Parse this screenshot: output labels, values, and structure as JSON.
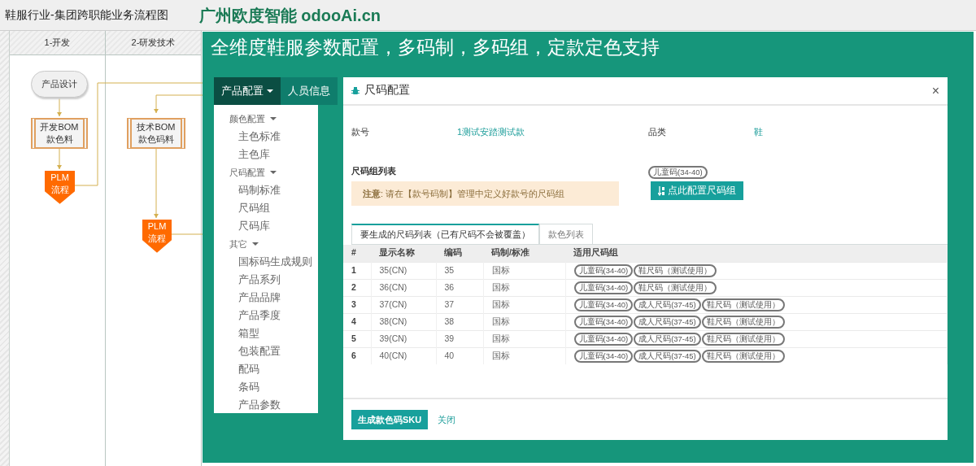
{
  "header": {
    "title": "鞋服行业-集团跨职能业务流程图",
    "brand": "广州欧度智能 odooAi.cn"
  },
  "lanes": [
    {
      "label": "1-开发"
    },
    {
      "label": "2-研发技术"
    }
  ],
  "flow_nodes": [
    {
      "kind": "terminal",
      "lines": [
        "产品设计"
      ]
    },
    {
      "kind": "process",
      "lines": [
        "开发BOM",
        "款色料"
      ]
    },
    {
      "kind": "offpage",
      "lines": [
        "PLM",
        "流程"
      ]
    },
    {
      "kind": "process",
      "lines": [
        "技术BOM",
        "款色码料"
      ]
    },
    {
      "kind": "offpage",
      "lines": [
        "PLM",
        "流程"
      ]
    }
  ],
  "panel": {
    "heading": "全维度鞋服参数配置，多码制，多码组，定款定色支持",
    "nav": [
      {
        "label": "产品配置",
        "selected": true,
        "dropdown": true
      },
      {
        "label": "人员信息",
        "selected": false,
        "dropdown": false
      }
    ],
    "menu": [
      {
        "label": "颜色配置",
        "children": [
          {
            "label": "主色标准"
          },
          {
            "label": "主色库"
          }
        ]
      },
      {
        "label": "尺码配置",
        "children": [
          {
            "label": "码制标准"
          },
          {
            "label": "尺码组"
          },
          {
            "label": "尺码库"
          }
        ]
      },
      {
        "label": "其它",
        "children": [
          {
            "label": "国标码生成规则"
          },
          {
            "label": "产品系列"
          },
          {
            "label": "产品品牌"
          },
          {
            "label": "产品季度"
          },
          {
            "label": "箱型"
          },
          {
            "label": "包装配置"
          },
          {
            "label": "配码"
          },
          {
            "label": "条码"
          },
          {
            "label": "产品参数"
          }
        ]
      }
    ]
  },
  "modal": {
    "title": "尺码配置",
    "close": "×",
    "fields": [
      {
        "label": "款号",
        "value": "1测试安踏测试款"
      },
      {
        "label": "品类",
        "value": "鞋"
      }
    ],
    "size_groups_label": "尺码组列表",
    "notice": "**注意**: 请在【款号码制】管理中定义好款号的尺码组",
    "size_group_tags": [
      "儿童码(34-40)"
    ],
    "config_button": "点此配置尺码组",
    "tabs": [
      {
        "label": "要生成的尺码列表（已有尺码不会被覆盖）",
        "selected": true
      },
      {
        "label": "款色列表",
        "selected": false
      }
    ],
    "table": {
      "columns": [
        "#",
        "显示名称",
        "编码",
        "码制/标准",
        "适用尺码组"
      ],
      "rows": [
        {
          "cells": [
            "1",
            "35(CN)",
            "35",
            "国标"
          ],
          "groups": [
            "儿童码(34-40)",
            "鞋尺码（测试使用）"
          ]
        },
        {
          "cells": [
            "2",
            "36(CN)",
            "36",
            "国标"
          ],
          "groups": [
            "儿童码(34-40)",
            "鞋尺码（测试使用）"
          ]
        },
        {
          "cells": [
            "3",
            "37(CN)",
            "37",
            "国标"
          ],
          "groups": [
            "儿童码(34-40)",
            "成人尺码(37-45)",
            "鞋尺码（测试使用）"
          ]
        },
        {
          "cells": [
            "4",
            "38(CN)",
            "38",
            "国标"
          ],
          "groups": [
            "儿童码(34-40)",
            "成人尺码(37-45)",
            "鞋尺码（测试使用）"
          ]
        },
        {
          "cells": [
            "5",
            "39(CN)",
            "39",
            "国标"
          ],
          "groups": [
            "儿童码(34-40)",
            "成人尺码(37-45)",
            "鞋尺码（测试使用）"
          ]
        },
        {
          "cells": [
            "6",
            "40(CN)",
            "40",
            "国标"
          ],
          "groups": [
            "儿童码(34-40)",
            "成人尺码(37-45)",
            "鞋尺码（测试使用）"
          ]
        }
      ]
    },
    "footer": {
      "primary": "生成款色码SKU",
      "secondary": "关闭"
    }
  }
}
